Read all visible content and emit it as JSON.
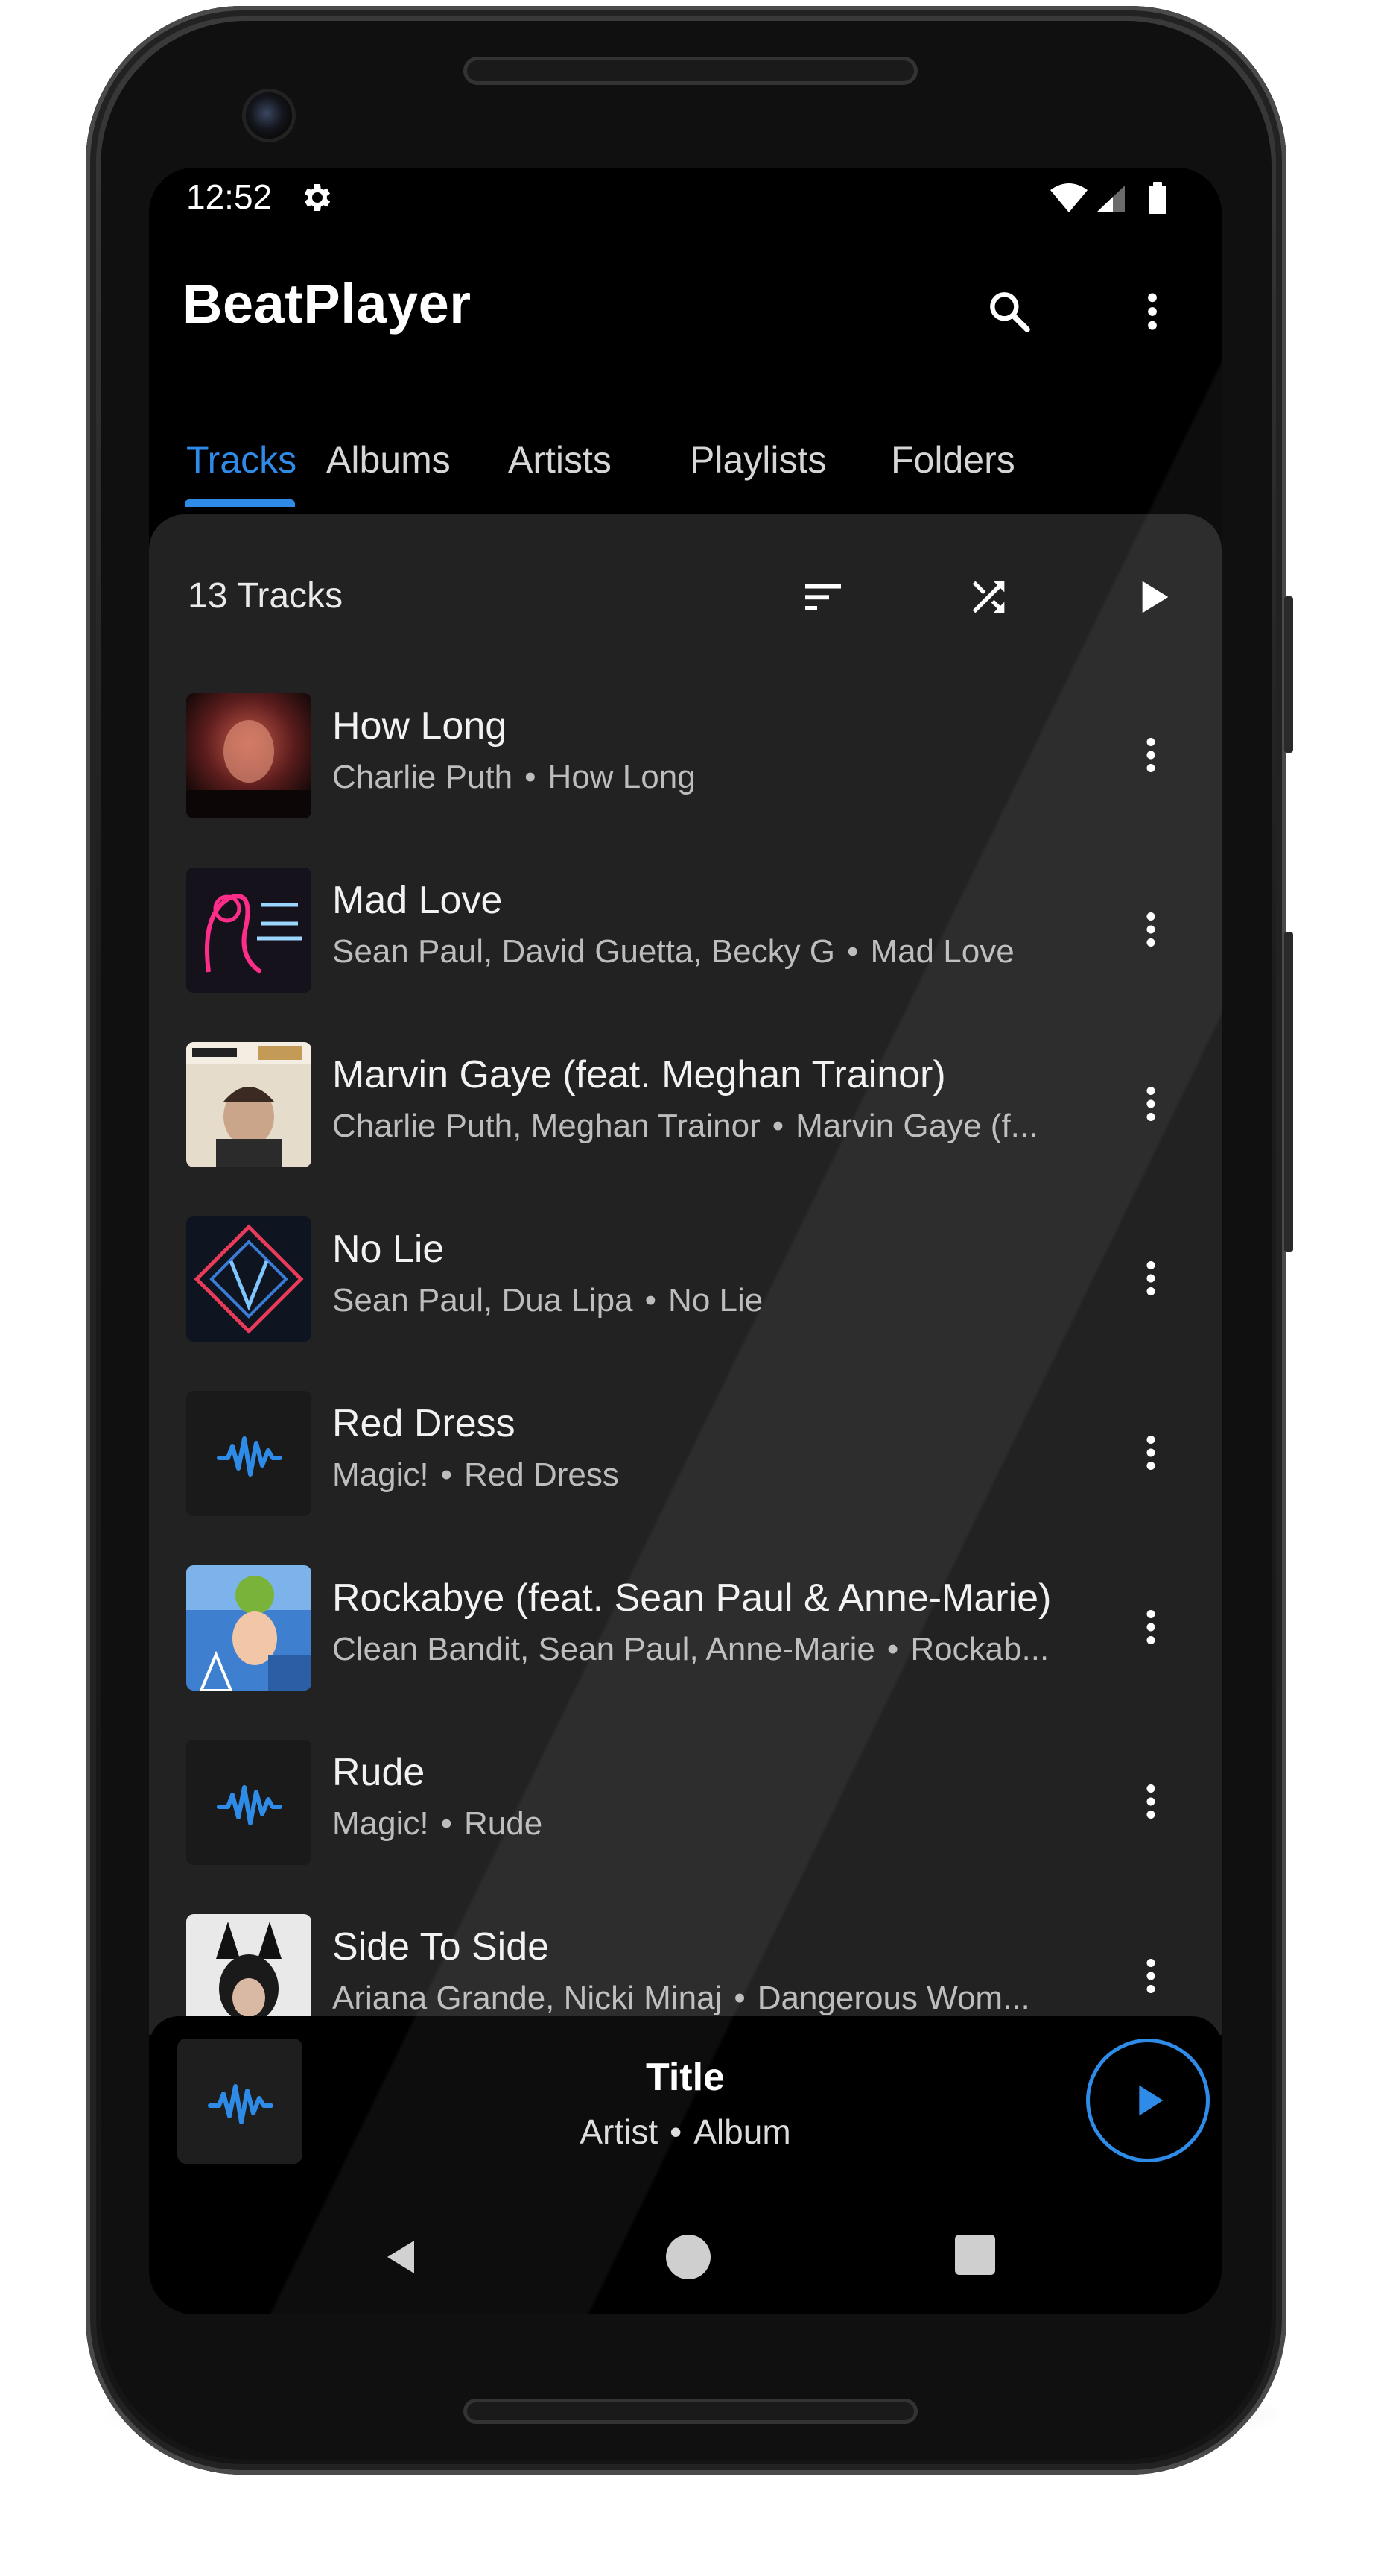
{
  "status_bar": {
    "time": "12:52"
  },
  "app_bar": {
    "title": "BeatPlayer"
  },
  "tabs": [
    {
      "label": "Tracks",
      "active": true
    },
    {
      "label": "Albums",
      "active": false
    },
    {
      "label": "Artists",
      "active": false
    },
    {
      "label": "Playlists",
      "active": false
    },
    {
      "label": "Folders",
      "active": false
    }
  ],
  "list_header": {
    "count_label": "13 Tracks"
  },
  "tracks": [
    {
      "title": "How Long",
      "artist": "Charlie Puth",
      "album": "How Long",
      "art": "photo-red"
    },
    {
      "title": "Mad Love",
      "artist": "Sean Paul, David Guetta, Becky G",
      "album": "Mad Love",
      "art": "neon-pink"
    },
    {
      "title": "Marvin Gaye (feat. Meghan Trainor)",
      "artist": "Charlie Puth, Meghan Trainor",
      "album": "Marvin Gaye (f...",
      "art": "photo-beige"
    },
    {
      "title": "No Lie",
      "artist": "Sean Paul, Dua Lipa",
      "album": "No Lie",
      "art": "neon-blue"
    },
    {
      "title": "Red Dress",
      "artist": "Magic!",
      "album": "Red Dress",
      "art": "placeholder-wave"
    },
    {
      "title": "Rockabye (feat. Sean Paul & Anne-Marie)",
      "artist": "Clean Bandit, Sean Paul, Anne-Marie",
      "album": "Rockab...",
      "art": "collage-blue"
    },
    {
      "title": "Rude",
      "artist": "Magic!",
      "album": "Rude",
      "art": "placeholder-wave"
    },
    {
      "title": "Side To Side",
      "artist": "Ariana Grande, Nicki Minaj",
      "album": "Dangerous Wom...",
      "art": "photo-mono"
    }
  ],
  "mini_player": {
    "title": "Title",
    "artist": "Artist",
    "album": "Album"
  },
  "separator": "•",
  "colors": {
    "accent": "#2f8be8",
    "surface": "#222222",
    "background": "#000000"
  }
}
